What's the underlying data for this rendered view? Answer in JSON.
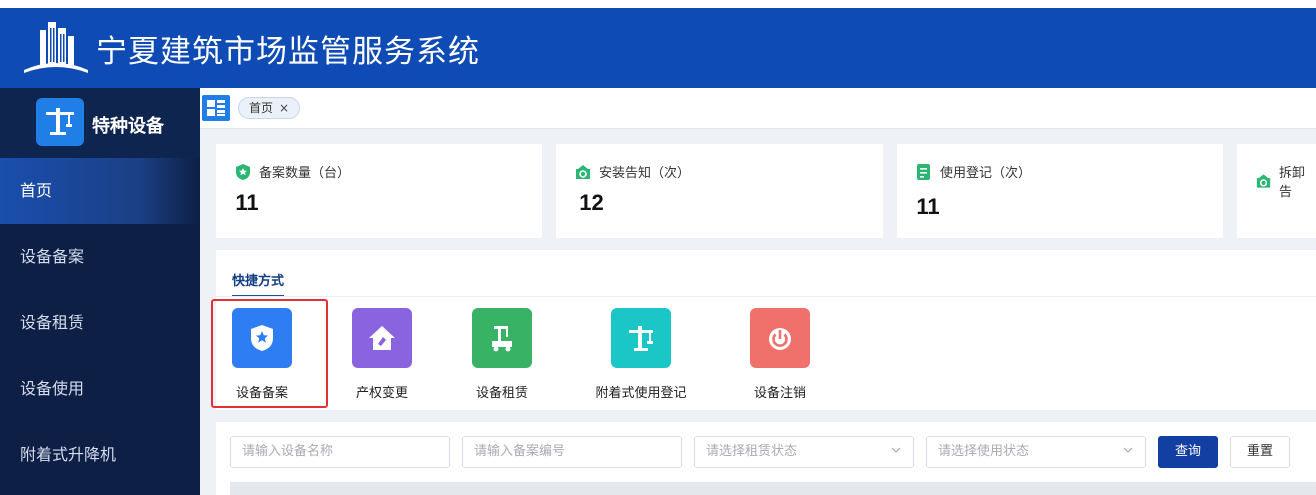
{
  "header": {
    "title": "宁夏建筑市场监管服务系统",
    "logo_icon": "building-logo-icon"
  },
  "sidebar": {
    "module_label": "特种设备",
    "module_icon": "tower-crane-icon",
    "items": [
      {
        "label": "首页",
        "active": true
      },
      {
        "label": "设备备案",
        "active": false
      },
      {
        "label": "设备租赁",
        "active": false
      },
      {
        "label": "设备使用",
        "active": false
      },
      {
        "label": "附着式升降机",
        "active": false
      }
    ]
  },
  "tabs": [
    {
      "label": "首页",
      "close": "×"
    }
  ],
  "stats": [
    {
      "label": "备案数量（台）",
      "value": "11",
      "icon": "shield-icon"
    },
    {
      "label": "安装告知（次）",
      "value": "12",
      "icon": "notice-icon"
    },
    {
      "label": "使用登记（次）",
      "value": "11",
      "icon": "register-icon"
    },
    {
      "label": "拆卸告",
      "value": "",
      "icon": "notice-icon"
    }
  ],
  "quick": {
    "title": "快捷方式",
    "items": [
      {
        "label": "设备备案",
        "color": "#2f7df2",
        "icon": "shield-star-icon"
      },
      {
        "label": "产权变更",
        "color": "#8a63e0",
        "icon": "house-icon"
      },
      {
        "label": "设备租赁",
        "color": "#38b264",
        "icon": "crane-truck-icon"
      },
      {
        "label": "附着式使用登记",
        "color": "#1bc6c6",
        "icon": "tower-crane-icon"
      },
      {
        "label": "设备注销",
        "color": "#f0706c",
        "icon": "power-icon"
      }
    ]
  },
  "filters": {
    "name_placeholder": "请输入设备名称",
    "code_placeholder": "请输入备案编号",
    "rent_status_placeholder": "请选择租赁状态",
    "use_status_placeholder": "请选择使用状态",
    "search_label": "查询",
    "reset_label": "重置"
  },
  "colors": {
    "header_bg": "#0f4bb4",
    "sidebar_bg": "#0d1f45",
    "accent": "#133fa3",
    "highlight": "#e23131"
  }
}
